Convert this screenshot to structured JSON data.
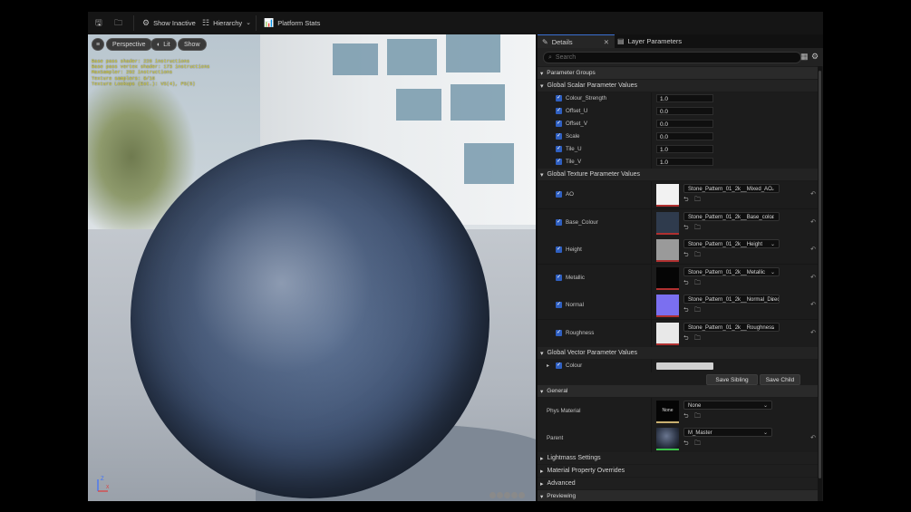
{
  "toolbar": {
    "save_icon": "save-icon",
    "browse_icon": "browse-icon",
    "show_inactive": "Show Inactive",
    "hierarchy": "Hierarchy",
    "platform_stats": "Platform Stats"
  },
  "viewport": {
    "menu_icon": "hamburger-icon",
    "perspective": "Perspective",
    "lit": "Lit",
    "show": "Show",
    "stats": [
      "Base pass shader: 226 instructions",
      "Base pass vertex shader: 173 instructions",
      "MaxSampler: 292 instructions",
      "Texture samplers: 9/16",
      "Texture Lookups (Est.): VS(4), PS(5)"
    ],
    "axis_labels": {
      "z": "Z",
      "x": "X"
    }
  },
  "details": {
    "tab_details": "Details",
    "tab_layers": "Layer Parameters",
    "search_placeholder": "Search",
    "sections": {
      "parameter_groups": "Parameter Groups",
      "scalar": "Global Scalar Parameter Values",
      "texture": "Global Texture Parameter Values",
      "vector": "Global Vector Parameter Values",
      "general": "General",
      "lightmass": "Lightmass Settings",
      "overrides": "Material Property Overrides",
      "advanced": "Advanced",
      "previewing": "Previewing"
    },
    "scalars": [
      {
        "name": "Colour_Strength",
        "value": "1.0"
      },
      {
        "name": "Offset_U",
        "value": "0.0"
      },
      {
        "name": "Offset_V",
        "value": "0.0"
      },
      {
        "name": "Scale",
        "value": "0.0"
      },
      {
        "name": "Tile_U",
        "value": "1.0"
      },
      {
        "name": "Tile_V",
        "value": "1.0"
      }
    ],
    "textures": [
      {
        "name": "AO",
        "asset": "Stone_Pattern_01_2k__Mixed_AO",
        "swatch": "#f2f2f2"
      },
      {
        "name": "Base_Colour",
        "asset": "Stone_Pattern_01_2k__Base_color",
        "swatch": "#2f3b4d"
      },
      {
        "name": "Height",
        "asset": "Stone_Pattern_01_2k__Height",
        "swatch": "#9a9a9a"
      },
      {
        "name": "Metallic",
        "asset": "Stone_Pattern_01_2k__Metallic",
        "swatch": "#050505"
      },
      {
        "name": "Normal",
        "asset": "Stone_Pattern_01_2k__Normal_DirectX",
        "swatch": "#7b6ff0"
      },
      {
        "name": "Roughness",
        "asset": "Stone_Pattern_01_2k__Roughness",
        "swatch": "#e8e8e8"
      }
    ],
    "vector": {
      "name": "Colour",
      "swatch": "#d0d0d0"
    },
    "save_sibling": "Save Sibling",
    "save_child": "Save Child",
    "general": {
      "phys_label": "Phys Material",
      "phys_thumb": "None",
      "phys_value": "None",
      "parent_label": "Parent",
      "parent_value": "M_Master"
    }
  },
  "colors": {
    "accent": "#2f5fc0",
    "panel_bg": "#1b1b1b",
    "stats_text": "#e7e046"
  }
}
